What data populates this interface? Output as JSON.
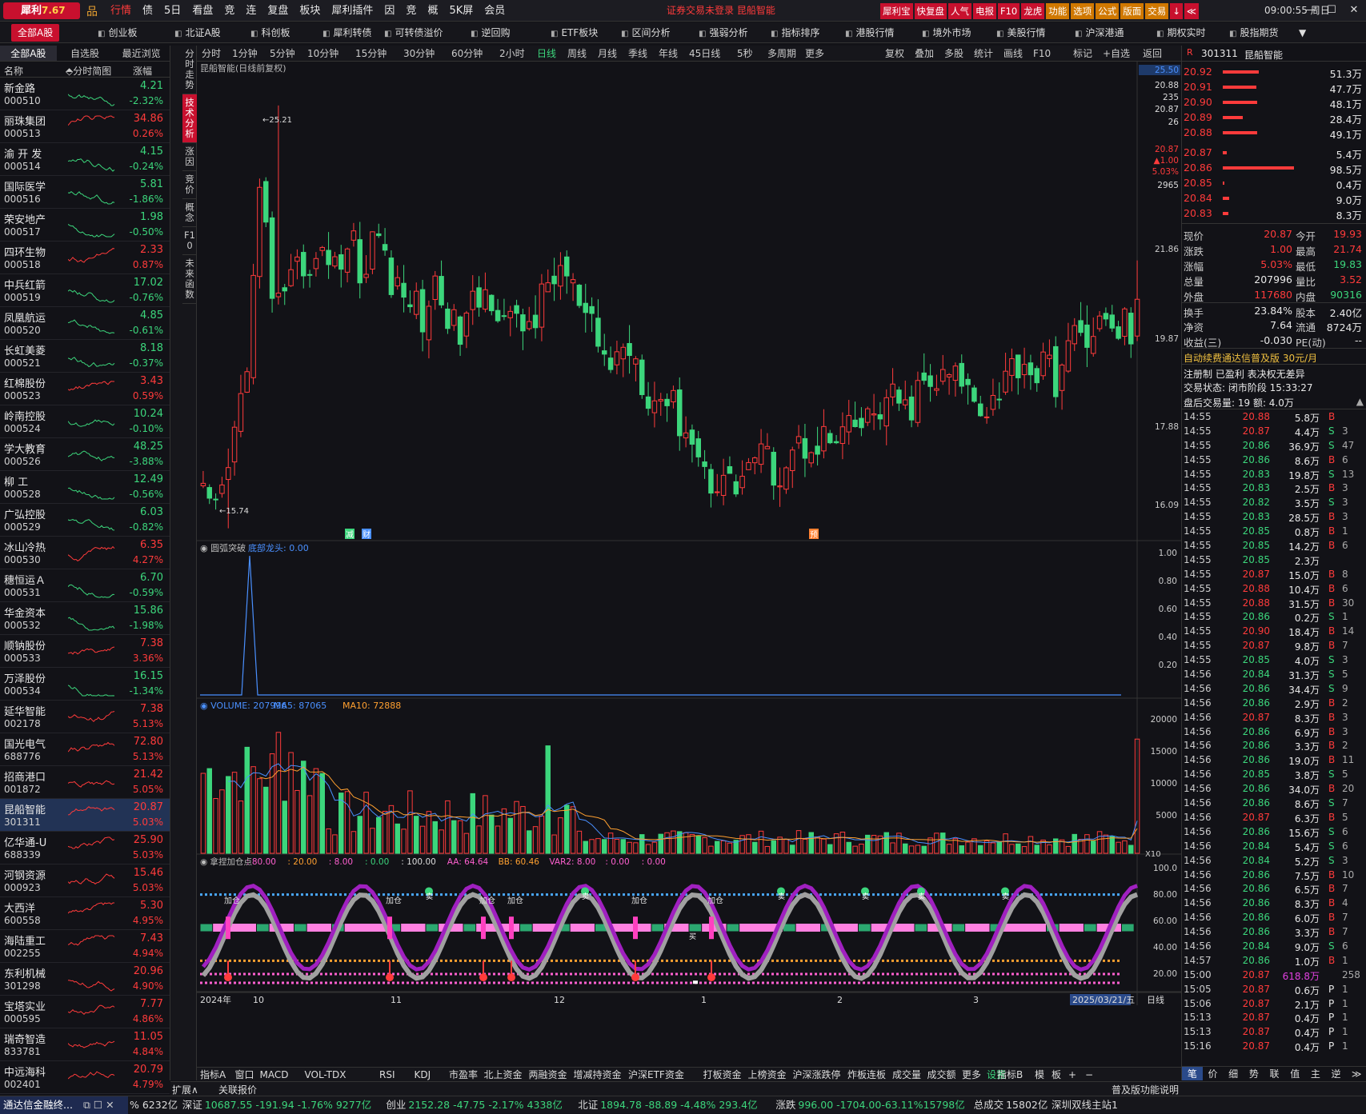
{
  "app": {
    "name": "犀利",
    "version": "7.67",
    "notice": "证券交易未登录 昆船智能",
    "clock": "09:00:55 周日",
    "menu": [
      "行情",
      "债",
      "5日",
      "看盘",
      "竞",
      "连",
      "复盘",
      "板块",
      "犀利插件",
      "因",
      "竞",
      "概",
      "5K屏",
      "会员"
    ],
    "right_buttons": [
      "犀利宝",
      "快复盘",
      "人气",
      "电报",
      "F10",
      "龙虎",
      "功能",
      "选项",
      "公式",
      "版面",
      "交易",
      "↓",
      "≪"
    ]
  },
  "tabs": [
    "全部A股",
    "创业板",
    "北证A股",
    "科创板",
    "犀利转债",
    "可转债溢价",
    "逆回购",
    "ETF板块",
    "区间分析",
    "强弱分析",
    "指标排序",
    "港股行情",
    "境外市场",
    "美股行情",
    "沪深港通",
    "期权实时",
    "股指期货"
  ],
  "left": {
    "tabs": [
      "全部A股",
      "自选股",
      "最近浏览"
    ],
    "head": {
      "name": "名称",
      "chart": "分时简图",
      "chg": "涨幅"
    },
    "stocks": [
      {
        "n": "新金路",
        "c": "000510",
        "p": "4.21",
        "r": "-2.32%",
        "d": -1
      },
      {
        "n": "丽珠集团",
        "c": "000513",
        "p": "34.86",
        "r": "0.26%",
        "d": 1
      },
      {
        "n": "渝 开 发",
        "c": "000514",
        "p": "4.15",
        "r": "-0.24%",
        "d": -1
      },
      {
        "n": "国际医学",
        "c": "000516",
        "p": "5.81",
        "r": "-1.86%",
        "d": -1
      },
      {
        "n": "荣安地产",
        "c": "000517",
        "p": "1.98",
        "r": "-0.50%",
        "d": -1
      },
      {
        "n": "四环生物",
        "c": "000518",
        "p": "2.33",
        "r": "0.87%",
        "d": 1
      },
      {
        "n": "中兵红箭",
        "c": "000519",
        "p": "17.02",
        "r": "-0.76%",
        "d": -1
      },
      {
        "n": "凤凰航运",
        "c": "000520",
        "p": "4.85",
        "r": "-0.61%",
        "d": -1
      },
      {
        "n": "长虹美菱",
        "c": "000521",
        "p": "8.18",
        "r": "-0.37%",
        "d": -1
      },
      {
        "n": "红棉股份",
        "c": "000523",
        "p": "3.43",
        "r": "0.59%",
        "d": 1
      },
      {
        "n": "岭南控股",
        "c": "000524",
        "p": "10.24",
        "r": "-0.10%",
        "d": -1
      },
      {
        "n": "学大教育",
        "c": "000526",
        "p": "48.25",
        "r": "-3.88%",
        "d": -1
      },
      {
        "n": "柳 工",
        "c": "000528",
        "p": "12.49",
        "r": "-0.56%",
        "d": -1
      },
      {
        "n": "广弘控股",
        "c": "000529",
        "p": "6.03",
        "r": "-0.82%",
        "d": -1
      },
      {
        "n": "冰山冷热",
        "c": "000530",
        "p": "6.35",
        "r": "4.27%",
        "d": 1
      },
      {
        "n": "穗恒运Ａ",
        "c": "000531",
        "p": "6.70",
        "r": "-0.59%",
        "d": -1
      },
      {
        "n": "华金资本",
        "c": "000532",
        "p": "15.86",
        "r": "-1.98%",
        "d": -1
      },
      {
        "n": "顺钠股份",
        "c": "000533",
        "p": "7.38",
        "r": "3.36%",
        "d": 1
      },
      {
        "n": "万泽股份",
        "c": "000534",
        "p": "16.15",
        "r": "-1.34%",
        "d": -1
      },
      {
        "n": "延华智能",
        "c": "002178",
        "p": "7.38",
        "r": "5.13%",
        "d": 1
      },
      {
        "n": "国光电气",
        "c": "688776",
        "p": "72.80",
        "r": "5.13%",
        "d": 1
      },
      {
        "n": "招商港口",
        "c": "001872",
        "p": "21.42",
        "r": "5.05%",
        "d": 1
      },
      {
        "n": "昆船智能",
        "c": "301311",
        "p": "20.87",
        "r": "5.03%",
        "d": 1,
        "sel": true
      },
      {
        "n": "亿华通-U",
        "c": "688339",
        "p": "25.90",
        "r": "5.03%",
        "d": 1
      },
      {
        "n": "河钢资源",
        "c": "000923",
        "p": "15.46",
        "r": "5.03%",
        "d": 1
      },
      {
        "n": "大西洋",
        "c": "600558",
        "p": "5.30",
        "r": "4.95%",
        "d": 1
      },
      {
        "n": "海陆重工",
        "c": "002255",
        "p": "7.43",
        "r": "4.94%",
        "d": 1
      },
      {
        "n": "东利机械",
        "c": "301298",
        "p": "20.96",
        "r": "4.90%",
        "d": 1
      },
      {
        "n": "宝塔实业",
        "c": "000595",
        "p": "7.77",
        "r": "4.86%",
        "d": 1
      },
      {
        "n": "瑞奇智造",
        "c": "833781",
        "p": "11.05",
        "r": "4.84%",
        "d": 1
      },
      {
        "n": "中远海科",
        "c": "002401",
        "p": "20.79",
        "r": "4.79%",
        "d": 1
      }
    ]
  },
  "vtabs": [
    "分时走势",
    "技术分析",
    "涨因",
    "竞价",
    "概念",
    "F10",
    "未来函数"
  ],
  "periods": [
    "分时",
    "1分钟",
    "5分钟",
    "10分钟",
    "15分钟",
    "30分钟",
    "60分钟",
    "2小时",
    "日线",
    "周线",
    "月线",
    "季线",
    "年线",
    "45日线",
    "5秒",
    "多周期",
    "更多"
  ],
  "periods_right": [
    "复权",
    "叠加",
    "多股",
    "统计",
    "画线",
    "F10",
    "标记",
    "+自选",
    "返回"
  ],
  "main": {
    "title": "昆船智能(日线前复权)",
    "hi_label": "25.21",
    "lo_label": "15.74",
    "tags": [
      "减",
      "财",
      "预"
    ],
    "yaxis": [
      "25.50",
      "20.88",
      "235",
      "20.87",
      "26",
      "20.87",
      "▲1.00",
      "5.03%",
      "2965",
      "21.86",
      "19.87",
      "17.88",
      "16.09"
    ]
  },
  "ind1": {
    "name": "圆弧突破",
    "param": "底部龙头: 0.00",
    "yaxis": [
      "1.00",
      "0.80",
      "0.60",
      "0.40",
      "0.20"
    ]
  },
  "vol": {
    "label": "VOLUME: 207996",
    "ma5": "MA5: 87065",
    "ma10": "MA10: 72888",
    "yaxis": [
      "20000",
      "15000",
      "10000",
      "5000"
    ],
    "unit": "X10"
  },
  "ind3": {
    "name": "拿捏加仓点",
    "params": [
      ": 80.00",
      ": 20.00",
      ": 8.00",
      ": 0.00",
      ": 100.00",
      "AA: 64.64",
      "BB: 60.46",
      "VAR2: 8.00",
      ": 0.00",
      ": 0.00"
    ],
    "yaxis": [
      "100.0",
      "80.00",
      "60.00",
      "40.00",
      "20.00"
    ],
    "markers": [
      "加仓",
      "加仓",
      "加仓",
      "加仓",
      "加仓",
      "加仓",
      "加仓",
      "卖",
      "卖",
      "卖",
      "卖",
      "卖",
      "卖",
      "买"
    ]
  },
  "xaxis": [
    "2024年",
    "10",
    "11",
    "12",
    "1",
    "2",
    "3",
    "2025/03/21/五",
    "日线"
  ],
  "btmtabs": [
    "指标A",
    "窗口",
    "MACD",
    "VOL-TDX",
    "RSI",
    "KDJ",
    "市盈率",
    "北上资金",
    "两融资金",
    "增减持资金",
    "沪深ETF资金",
    "打板资金",
    "上榜资金",
    "沪深涨跌停",
    "炸板连板",
    "成交量",
    "成交额",
    "更多",
    "设置",
    "指标B",
    "模",
    "板",
    "+",
    "−"
  ],
  "btmtabs2": [
    "扩展∧",
    "关联报价",
    "普及版功能说明"
  ],
  "right": {
    "code": "301311",
    "name": "昆船智能",
    "orders": [
      {
        "p": "20.92",
        "v": "51.3万",
        "w": 55
      },
      {
        "p": "20.91",
        "v": "47.7万",
        "w": 51
      },
      {
        "p": "20.90",
        "v": "48.1万",
        "w": 52
      },
      {
        "p": "20.89",
        "v": "28.4万",
        "w": 31
      },
      {
        "p": "20.88",
        "v": "49.1万",
        "w": 53
      },
      {
        "p": "20.87",
        "v": "5.4万",
        "w": 6
      },
      {
        "p": "20.86",
        "v": "98.5万",
        "w": 108
      },
      {
        "p": "20.85",
        "v": "0.4万",
        "w": 2
      },
      {
        "p": "20.84",
        "v": "9.0万",
        "w": 10
      },
      {
        "p": "20.83",
        "v": "8.3万",
        "w": 9
      }
    ],
    "quote": [
      [
        "现价",
        "20.87",
        "今开",
        "19.93"
      ],
      [
        "涨跌",
        "1.00",
        "最高",
        "21.74"
      ],
      [
        "涨幅",
        "5.03%",
        "最低",
        "19.83"
      ],
      [
        "总量",
        "207996",
        "量比",
        "3.52"
      ],
      [
        "外盘",
        "117680",
        "内盘",
        "90316"
      ],
      [
        "换手",
        "23.84%",
        "股本",
        "2.40亿"
      ],
      [
        "净资",
        "7.64",
        "流通",
        "8724万"
      ],
      [
        "收益(三)",
        "-0.030",
        "PE(动)",
        "--"
      ]
    ],
    "promo": "自动续费通达信普及版 30元/月",
    "info1": "注册制 已盈利 表决权无差异",
    "info2": "交易状态: 闭市阶段 15:33:27",
    "info3": "盘后交易量: 19 额: 4.0万",
    "ticks": [
      [
        "14:55",
        "20.88",
        "5.8万",
        "B",
        ""
      ],
      [
        "14:55",
        "20.87",
        "4.4万",
        "S",
        "3"
      ],
      [
        "14:55",
        "20.86",
        "36.9万",
        "S",
        "47"
      ],
      [
        "14:55",
        "20.86",
        "8.6万",
        "B",
        "6"
      ],
      [
        "14:55",
        "20.83",
        "19.8万",
        "S",
        "13"
      ],
      [
        "14:55",
        "20.83",
        "2.5万",
        "B",
        "3"
      ],
      [
        "14:55",
        "20.82",
        "3.5万",
        "S",
        "3"
      ],
      [
        "14:55",
        "20.83",
        "28.5万",
        "B",
        "3"
      ],
      [
        "14:55",
        "20.85",
        "0.8万",
        "B",
        "1"
      ],
      [
        "14:55",
        "20.85",
        "14.2万",
        "B",
        "6"
      ],
      [
        "14:55",
        "20.85",
        "2.3万",
        "",
        ""
      ],
      [
        "14:55",
        "20.87",
        "15.0万",
        "B",
        "8"
      ],
      [
        "14:55",
        "20.88",
        "10.4万",
        "B",
        "6"
      ],
      [
        "14:55",
        "20.88",
        "31.5万",
        "B",
        "30"
      ],
      [
        "14:55",
        "20.86",
        "0.2万",
        "S",
        "1"
      ],
      [
        "14:55",
        "20.90",
        "18.4万",
        "B",
        "14"
      ],
      [
        "14:55",
        "20.87",
        "9.8万",
        "B",
        "7"
      ],
      [
        "14:55",
        "20.85",
        "4.0万",
        "S",
        "3"
      ],
      [
        "14:56",
        "20.84",
        "31.3万",
        "S",
        "5"
      ],
      [
        "14:56",
        "20.86",
        "34.4万",
        "S",
        "9"
      ],
      [
        "14:56",
        "20.86",
        "2.9万",
        "B",
        "2"
      ],
      [
        "14:56",
        "20.87",
        "8.3万",
        "B",
        "3"
      ],
      [
        "14:56",
        "20.86",
        "6.9万",
        "B",
        "3"
      ],
      [
        "14:56",
        "20.86",
        "3.3万",
        "B",
        "2"
      ],
      [
        "14:56",
        "20.86",
        "19.0万",
        "B",
        "11"
      ],
      [
        "14:56",
        "20.85",
        "3.8万",
        "S",
        "5"
      ],
      [
        "14:56",
        "20.86",
        "34.0万",
        "B",
        "20"
      ],
      [
        "14:56",
        "20.86",
        "8.6万",
        "S",
        "7"
      ],
      [
        "14:56",
        "20.87",
        "6.3万",
        "B",
        "5"
      ],
      [
        "14:56",
        "20.86",
        "15.6万",
        "S",
        "6"
      ],
      [
        "14:56",
        "20.84",
        "5.4万",
        "S",
        "6"
      ],
      [
        "14:56",
        "20.84",
        "5.2万",
        "S",
        "3"
      ],
      [
        "14:56",
        "20.86",
        "7.5万",
        "B",
        "10"
      ],
      [
        "14:56",
        "20.86",
        "6.5万",
        "B",
        "7"
      ],
      [
        "14:56",
        "20.86",
        "8.3万",
        "B",
        "4"
      ],
      [
        "14:56",
        "20.86",
        "6.0万",
        "B",
        "7"
      ],
      [
        "14:56",
        "20.86",
        "3.3万",
        "B",
        "7"
      ],
      [
        "14:56",
        "20.84",
        "9.0万",
        "S",
        "6"
      ],
      [
        "14:57",
        "20.86",
        "1.0万",
        "B",
        "1"
      ],
      [
        "15:00",
        "20.87",
        "618.8万",
        "",
        "258"
      ],
      [
        "15:05",
        "20.87",
        "0.6万",
        "P",
        "1"
      ],
      [
        "15:06",
        "20.87",
        "2.1万",
        "P",
        "1"
      ],
      [
        "15:13",
        "20.87",
        "0.4万",
        "P",
        "1"
      ],
      [
        "15:13",
        "20.87",
        "0.4万",
        "P",
        "1"
      ],
      [
        "15:16",
        "20.87",
        "0.4万",
        "P",
        "1"
      ]
    ],
    "bottom_tabs": [
      "笔",
      "价",
      "细",
      "势",
      "联",
      "值",
      "主",
      "逆",
      "≫"
    ]
  },
  "status": {
    "left": "通达信金融终...",
    "items": [
      {
        "k": "",
        "v": "% 6232亿"
      },
      {
        "k": "深证",
        "v": "10687.55 -191.94 -1.76% 9277亿"
      },
      {
        "k": "创业",
        "v": "2152.28 -47.75 -2.17% 4338亿"
      },
      {
        "k": "北证",
        "v": "1894.78 -88.89 -4.48% 293.4亿"
      },
      {
        "k": "涨跌",
        "v": "996.00 -1704.00-63.11%15798亿"
      },
      {
        "k": "总成交",
        "v": "15802亿"
      },
      {
        "k": "",
        "v": "深圳双线主站1"
      }
    ]
  },
  "colors": {
    "up": "#ff3b3b",
    "down": "#3cd67c",
    "ma5": "#4a90ff",
    "ma10": "#ffa030",
    "purple": "#a020c0",
    "pink": "#ff60d0",
    "accent": "#c8102e"
  }
}
